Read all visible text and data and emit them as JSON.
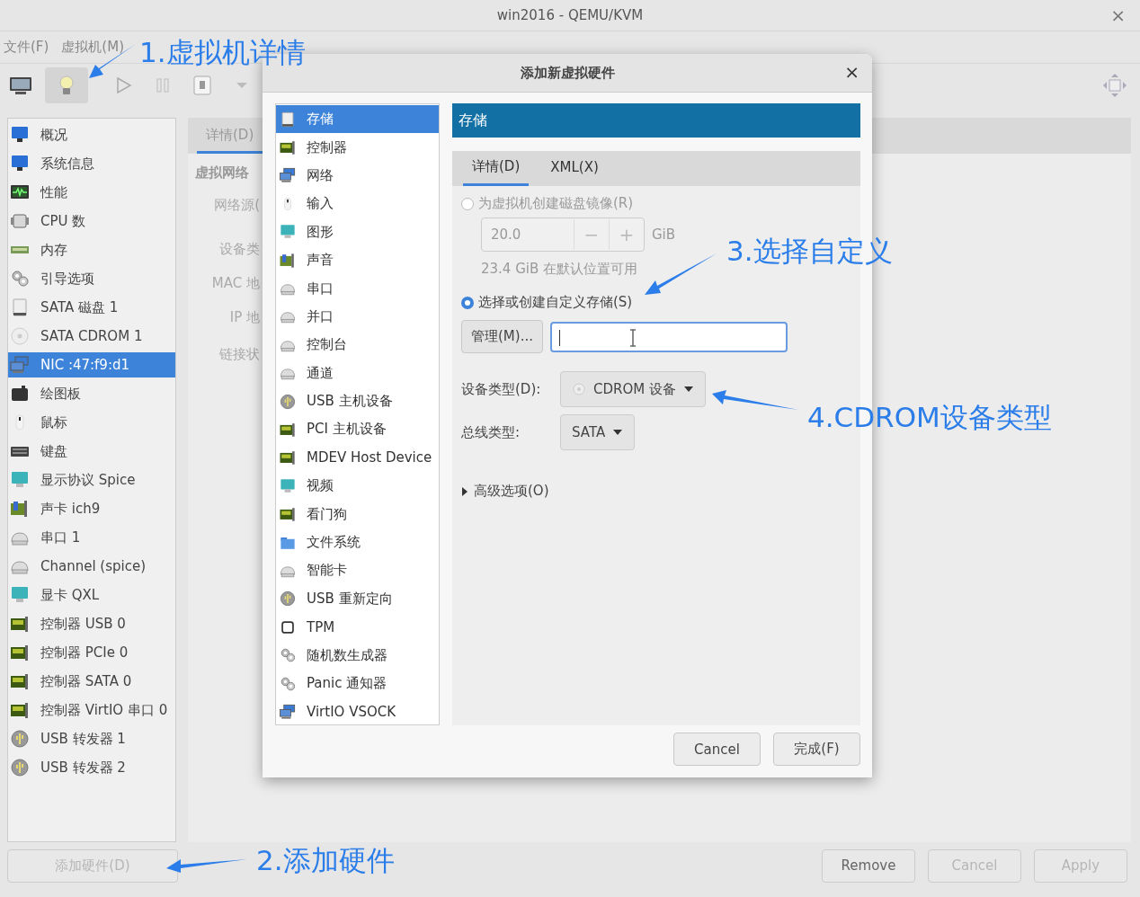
{
  "window": {
    "title": "win2016 - QEMU/KVM",
    "close": "×"
  },
  "menu": [
    "文件(F)",
    "虚拟机(M)"
  ],
  "toolbar": [
    {
      "kind": "console",
      "selected": false
    },
    {
      "kind": "details",
      "selected": true
    },
    {
      "kind": "play",
      "selected": false
    },
    {
      "kind": "pause",
      "selected": false
    },
    {
      "kind": "shutdown",
      "selected": false
    }
  ],
  "hardware_list": [
    {
      "label": "概况",
      "kind": "monitor",
      "selected": false
    },
    {
      "label": "系统信息",
      "kind": "monitor",
      "selected": false
    },
    {
      "label": "性能",
      "kind": "perf",
      "selected": false
    },
    {
      "label": "CPU 数",
      "kind": "cpu",
      "selected": false
    },
    {
      "label": "内存",
      "kind": "memory",
      "selected": false
    },
    {
      "label": "引导选项",
      "kind": "gears",
      "selected": false
    },
    {
      "label": "SATA 磁盘 1",
      "kind": "disk",
      "selected": false
    },
    {
      "label": "SATA CDROM 1",
      "kind": "cdrom",
      "selected": false
    },
    {
      "label": "NIC :47:f9:d1",
      "kind": "nic",
      "selected": true
    },
    {
      "label": "绘图板",
      "kind": "tablet",
      "selected": false
    },
    {
      "label": "鼠标",
      "kind": "mouse",
      "selected": false
    },
    {
      "label": "键盘",
      "kind": "keyboard",
      "selected": false
    },
    {
      "label": "显示协议 Spice",
      "kind": "display",
      "selected": false
    },
    {
      "label": "声卡 ich9",
      "kind": "sound",
      "selected": false
    },
    {
      "label": "串口 1",
      "kind": "serial",
      "selected": false
    },
    {
      "label": "Channel (spice)",
      "kind": "serial",
      "selected": false
    },
    {
      "label": "显卡 QXL",
      "kind": "display",
      "selected": false
    },
    {
      "label": "控制器 USB 0",
      "kind": "controller",
      "selected": false
    },
    {
      "label": "控制器 PCIe 0",
      "kind": "controller",
      "selected": false
    },
    {
      "label": "控制器 SATA 0",
      "kind": "controller",
      "selected": false
    },
    {
      "label": "控制器 VirtIO 串口 0",
      "kind": "controller",
      "selected": false
    },
    {
      "label": "USB 转发器 1",
      "kind": "usb",
      "selected": false
    },
    {
      "label": "USB 转发器 2",
      "kind": "usb",
      "selected": false
    }
  ],
  "details": {
    "tab": "详情(D)",
    "section": "虚拟网络",
    "labels": [
      "网络源(",
      "设备类",
      "MAC 地",
      "IP 地",
      "链接状"
    ]
  },
  "footer_buttons": [
    {
      "label": "添加硬件(D)",
      "disabled": true
    },
    {
      "label": "Remove",
      "disabled": false
    },
    {
      "label": "Cancel",
      "disabled": true
    },
    {
      "label": "Apply",
      "disabled": true
    }
  ],
  "dialog": {
    "title": "添加新虚拟硬件",
    "close": "×",
    "device_types": [
      {
        "label": "存储",
        "kind": "disk",
        "selected": true
      },
      {
        "label": "控制器",
        "kind": "controller",
        "selected": false
      },
      {
        "label": "网络",
        "kind": "nic",
        "selected": false
      },
      {
        "label": "输入",
        "kind": "mouse",
        "selected": false
      },
      {
        "label": "图形",
        "kind": "display",
        "selected": false
      },
      {
        "label": "声音",
        "kind": "sound",
        "selected": false
      },
      {
        "label": "串口",
        "kind": "serial",
        "selected": false
      },
      {
        "label": "并口",
        "kind": "serial",
        "selected": false
      },
      {
        "label": "控制台",
        "kind": "serial",
        "selected": false
      },
      {
        "label": "通道",
        "kind": "serial",
        "selected": false
      },
      {
        "label": "USB 主机设备",
        "kind": "usb",
        "selected": false
      },
      {
        "label": "PCI 主机设备",
        "kind": "controller",
        "selected": false
      },
      {
        "label": "MDEV Host Device",
        "kind": "controller",
        "selected": false
      },
      {
        "label": "视频",
        "kind": "display",
        "selected": false
      },
      {
        "label": "看门狗",
        "kind": "controller",
        "selected": false
      },
      {
        "label": "文件系统",
        "kind": "folder",
        "selected": false
      },
      {
        "label": "智能卡",
        "kind": "serial",
        "selected": false
      },
      {
        "label": "USB 重新定向",
        "kind": "usb",
        "selected": false
      },
      {
        "label": "TPM",
        "kind": "tpm",
        "selected": false
      },
      {
        "label": "随机数生成器",
        "kind": "gears",
        "selected": false
      },
      {
        "label": "Panic 通知器",
        "kind": "gears",
        "selected": false
      },
      {
        "label": "VirtIO VSOCK",
        "kind": "nic",
        "selected": false
      }
    ],
    "panel_title": "存储",
    "tabs": [
      {
        "label": "详情(D)",
        "selected": true
      },
      {
        "label": "XML(X)",
        "selected": false
      }
    ],
    "radios": [
      {
        "label": "为虚拟机创建磁盘镜像(R)",
        "checked": false,
        "disabled": true
      },
      {
        "label": "选择或创建自定义存储(S)",
        "checked": true,
        "disabled": false
      }
    ],
    "size": {
      "value": "20.0",
      "minus": "−",
      "plus": "+",
      "unit": "GiB"
    },
    "available": "23.4 GiB 在默认位置可用",
    "manage_button": "管理(M)...",
    "device_type": {
      "label": "设备类型(D):",
      "value": "CDROM 设备"
    },
    "bus_type": {
      "label": "总线类型:",
      "value": "SATA"
    },
    "advanced": {
      "label": "高级选项(O)",
      "expanded": false
    },
    "buttons": [
      "Cancel",
      "完成(F)"
    ]
  },
  "annotations": [
    {
      "text": "1.虚拟机详情"
    },
    {
      "text": "2.添加硬件"
    },
    {
      "text": "3.选择自定义"
    },
    {
      "text": "4.CDROM设备类型"
    }
  ]
}
